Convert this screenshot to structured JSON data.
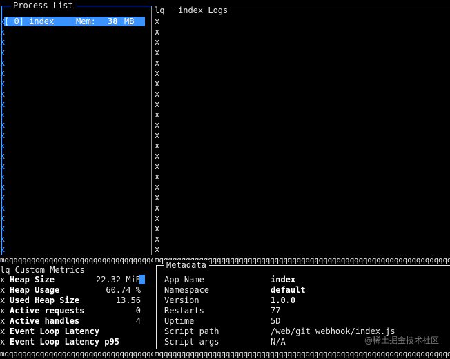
{
  "process_list": {
    "title": "Process List",
    "selected": {
      "index_label": "[ 0] index",
      "mem_label": "Mem:",
      "mem_value": "38",
      "mem_unit": "MB"
    }
  },
  "logs": {
    "title": "index Logs",
    "prefix": "lq"
  },
  "custom_metrics": {
    "title": "lq Custom Metrics",
    "rows": [
      {
        "label": "Heap Size",
        "value": "22.32 MiB"
      },
      {
        "label": "Heap Usage",
        "value": "60.74 %"
      },
      {
        "label": "Used Heap Size",
        "value": "13.56"
      },
      {
        "label": "Active requests",
        "value": "0"
      },
      {
        "label": "Active handles",
        "value": "4"
      },
      {
        "label": "Event Loop Latency",
        "value": ""
      },
      {
        "label": "Event Loop Latency p95",
        "value": ""
      }
    ]
  },
  "metadata": {
    "title": "Metadata",
    "rows": [
      {
        "key": "App Name",
        "value": "index"
      },
      {
        "key": "Namespace",
        "value": "default"
      },
      {
        "key": "Version",
        "value": "1.0.0"
      },
      {
        "key": "Restarts",
        "value": "77"
      },
      {
        "key": "Uptime",
        "value": "5D"
      },
      {
        "key": "Script path",
        "value": "/web/git_webhook/index.js"
      },
      {
        "key": "Script args",
        "value": "N/A"
      }
    ]
  },
  "watermark": "@稀土掘金技术社区",
  "colors": {
    "accent": "#3b93ff",
    "background": "#000000",
    "text": "#e6e6e6"
  }
}
